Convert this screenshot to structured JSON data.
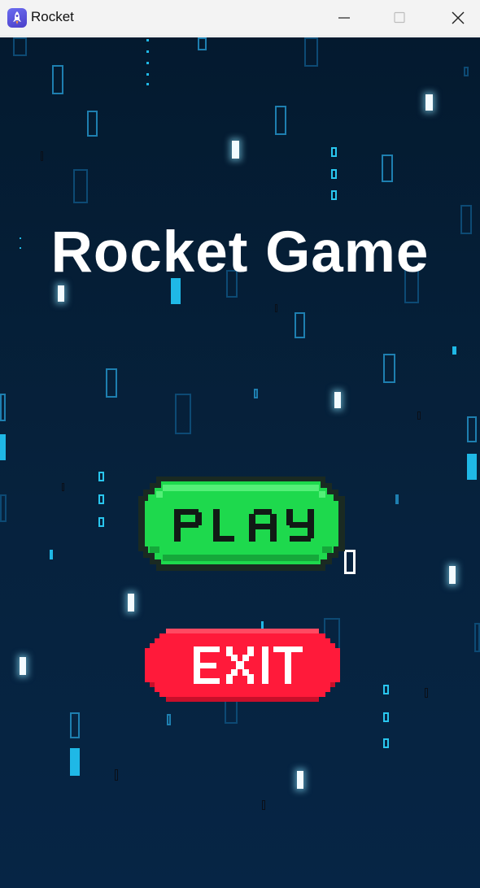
{
  "window": {
    "title": "Rocket",
    "icon": "rocket-app-icon",
    "controls": [
      "minimize-icon",
      "maximize-icon",
      "close-icon"
    ]
  },
  "game": {
    "title": "Rocket Game",
    "play_label": "PLAY",
    "exit_label": "EXIT"
  },
  "colors": {
    "background": "#041a2f",
    "play_green": "#1ed94d",
    "exit_red": "#ff1a3a",
    "particle_cyan": "#1fb8e6"
  }
}
